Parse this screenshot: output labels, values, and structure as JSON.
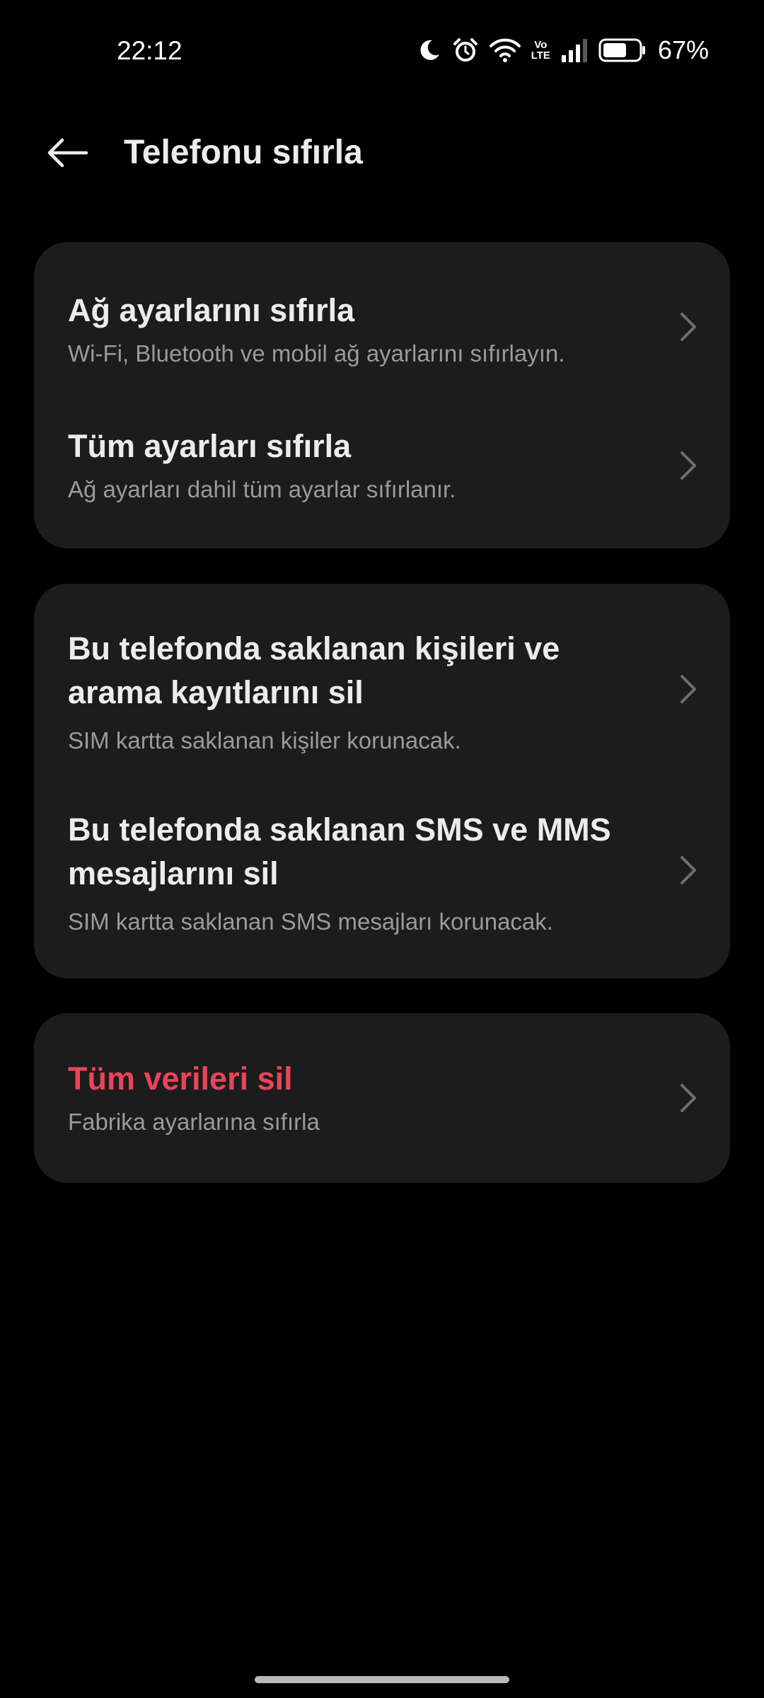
{
  "status_bar": {
    "time": "22:12",
    "volte_label_top": "Vo",
    "volte_label_bottom": "LTE",
    "battery_percent": "67%",
    "battery_level": 0.67,
    "icons": [
      "moon-icon",
      "alarm-icon",
      "wifi-icon",
      "volte-icon",
      "signal-icon",
      "battery-icon"
    ]
  },
  "header": {
    "title": "Telefonu sıfırla",
    "back_icon": "back-arrow-icon"
  },
  "groups": [
    {
      "items": [
        {
          "title": "Ağ ayarlarını sıfırla",
          "subtitle": "Wi-Fi, Bluetooth ve mobil ağ ayarlarını sıfırlayın."
        },
        {
          "title": "Tüm ayarları sıfırla",
          "subtitle": "Ağ ayarları dahil tüm ayarlar sıfırlanır."
        }
      ]
    },
    {
      "items": [
        {
          "title_line1": "Bu telefonda saklanan kişileri ve",
          "title_line2": "arama kayıtlarını sil",
          "subtitle": "SIM kartta saklanan kişiler korunacak."
        },
        {
          "title_line1": "Bu telefonda saklanan SMS ve MMS",
          "title_line2": "mesajlarını sil",
          "subtitle": "SIM kartta saklanan SMS mesajları korunacak."
        }
      ]
    },
    {
      "items": [
        {
          "title": "Tüm verileri sil",
          "subtitle": "Fabrika ayarlarına sıfırla"
        }
      ]
    }
  ],
  "colors": {
    "background": "#000000",
    "card": "#1c1c1c",
    "title_text": "#ececec",
    "subtitle_text": "#9a9a9a",
    "danger": "#e8455a",
    "chevron": "#6e6e6e"
  }
}
